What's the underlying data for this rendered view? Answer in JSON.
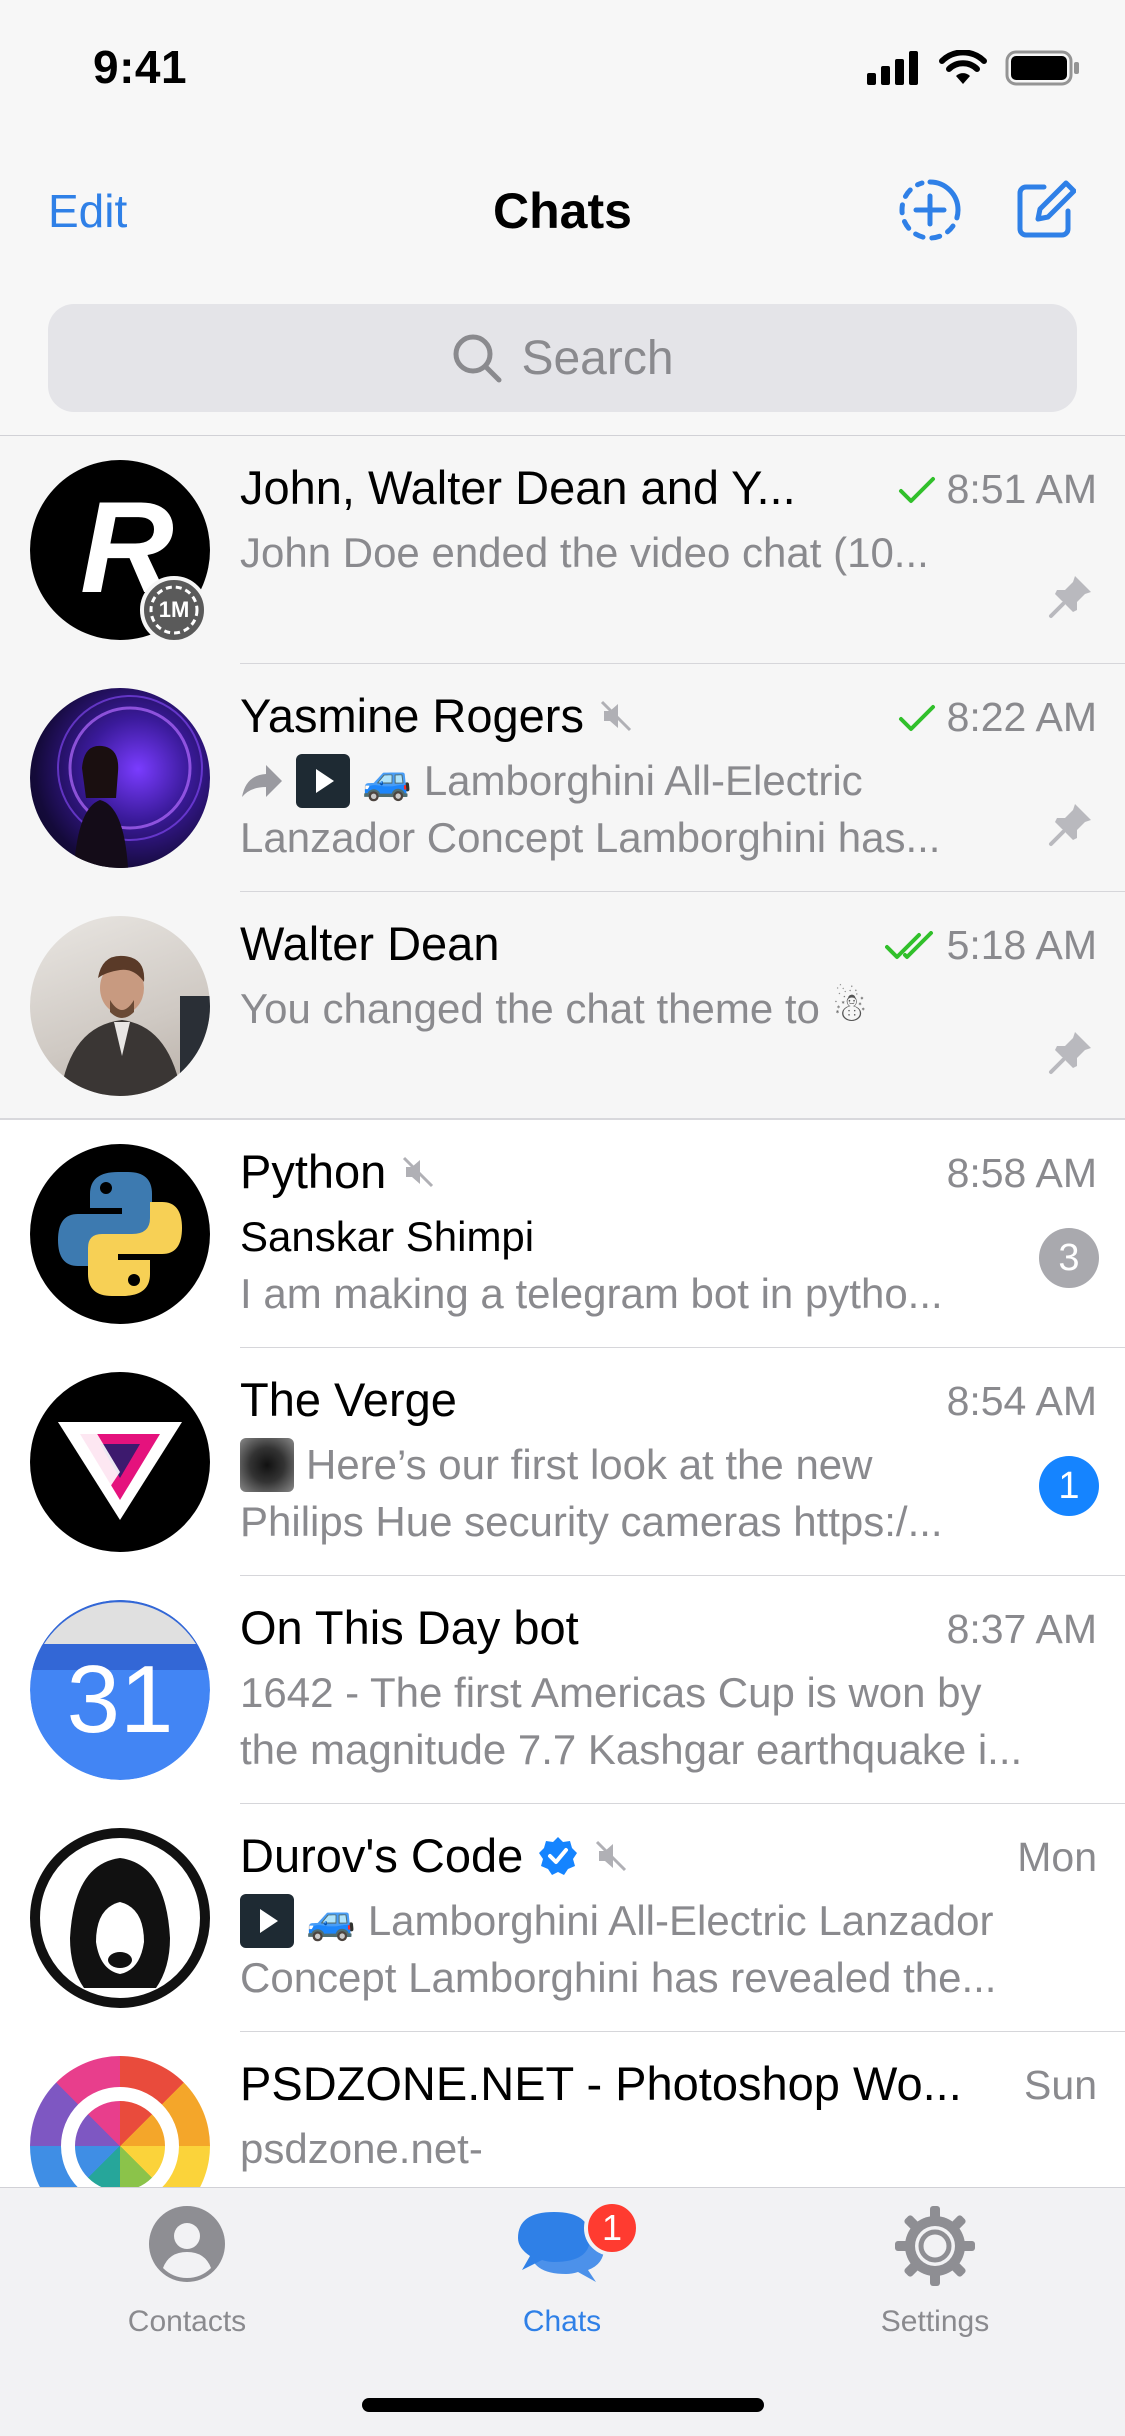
{
  "status_bar": {
    "time": "9:41"
  },
  "nav": {
    "edit_label": "Edit",
    "title": "Chats"
  },
  "search": {
    "placeholder": "Search"
  },
  "chats": [
    {
      "name": "John, Walter Dean and Y...",
      "time": "8:51 AM",
      "read_status": "sent",
      "preview": [
        "John Doe ended the video chat (10..."
      ],
      "pinned": true,
      "avatar_timer": "1M"
    },
    {
      "name": "Yasmine Rogers",
      "muted": true,
      "time": "8:22 AM",
      "read_status": "sent",
      "preview": [
        "Lamborghini All-Electric",
        "Lanzador Concept Lamborghini has..."
      ],
      "forwarded": true,
      "pinned": true
    },
    {
      "name": "Walter Dean",
      "time": "5:18 AM",
      "read_status": "read",
      "preview": [
        "You changed the chat theme to"
      ],
      "preview_emoji": "☃",
      "pinned": true
    },
    {
      "name": "Python",
      "muted": true,
      "time": "8:58 AM",
      "sender": "Sanskar Shimpi",
      "preview": [
        "I am making a telegram bot in pytho..."
      ],
      "unread": "3",
      "unread_muted": true
    },
    {
      "name": "The Verge",
      "time": "8:54 AM",
      "preview": [
        "Here’s our first look at the new",
        "Philips Hue security cameras https:/..."
      ],
      "unread": "1"
    },
    {
      "name": "On This Day bot",
      "time": "8:37 AM",
      "preview": [
        "1642 - The first Americas Cup is won by",
        "the magnitude 7.7 Kashgar earthquake i..."
      ],
      "avatar_text": "31"
    },
    {
      "name": "Durov's Code",
      "verified": true,
      "muted": true,
      "time": "Mon",
      "preview": [
        "Lamborghini All-Electric Lanzador",
        "Concept Lamborghini has revealed the..."
      ]
    },
    {
      "name": "PSDZONE.NET - Photoshop Wo...",
      "time": "Sun",
      "preview": [
        "psdzone.net-"
      ]
    }
  ],
  "tabs": [
    {
      "label": "Contacts",
      "icon": "person-circle-icon"
    },
    {
      "label": "Chats",
      "icon": "chat-bubbles-icon",
      "badge": "1",
      "active": true
    },
    {
      "label": "Settings",
      "icon": "gear-icon"
    }
  ],
  "colors": {
    "accent": "#2f80e7",
    "check_green": "#31c02b",
    "badge_blue": "#1584ff",
    "badge_red": "#ff3b30"
  }
}
